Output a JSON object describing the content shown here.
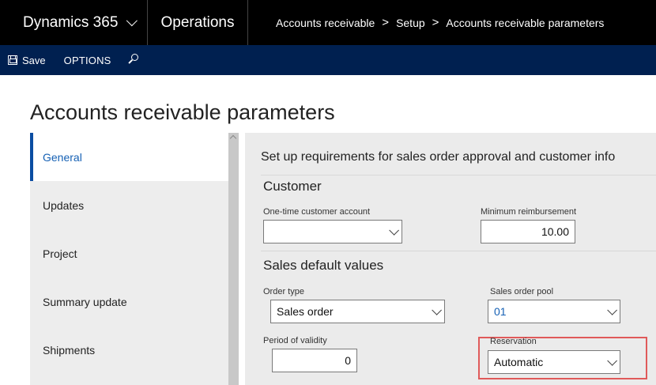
{
  "topbar": {
    "app_name": "Dynamics 365",
    "module": "Operations",
    "breadcrumb": [
      "Accounts receivable",
      "Setup",
      "Accounts receivable parameters"
    ]
  },
  "actionbar": {
    "save_label": "Save",
    "options_label": "OPTIONS",
    "save_icon": "save-icon",
    "search_icon": "search-icon"
  },
  "page": {
    "title": "Accounts receivable parameters"
  },
  "nav": {
    "items": [
      {
        "label": "General",
        "active": true
      },
      {
        "label": "Updates"
      },
      {
        "label": "Project"
      },
      {
        "label": "Summary update"
      },
      {
        "label": "Shipments"
      }
    ]
  },
  "content": {
    "intro": "Set up requirements for sales order approval and customer info",
    "customer": {
      "title": "Customer",
      "one_time_account": {
        "label": "One-time customer account",
        "value": ""
      },
      "minimum_reimbursement": {
        "label": "Minimum reimbursement",
        "value": "10.00"
      }
    },
    "sales_defaults": {
      "title": "Sales default values",
      "order_type": {
        "label": "Order type",
        "value": "Sales order"
      },
      "sales_order_pool": {
        "label": "Sales order pool",
        "value": "01"
      },
      "period_of_validity": {
        "label": "Period of validity",
        "value": "0"
      },
      "reservation": {
        "label": "Reservation",
        "value": "Automatic"
      }
    }
  },
  "colors": {
    "topbar_bg": "#000000",
    "actionbar_bg": "#002050",
    "accent": "#1560b4",
    "highlight": "#e05a5a"
  }
}
